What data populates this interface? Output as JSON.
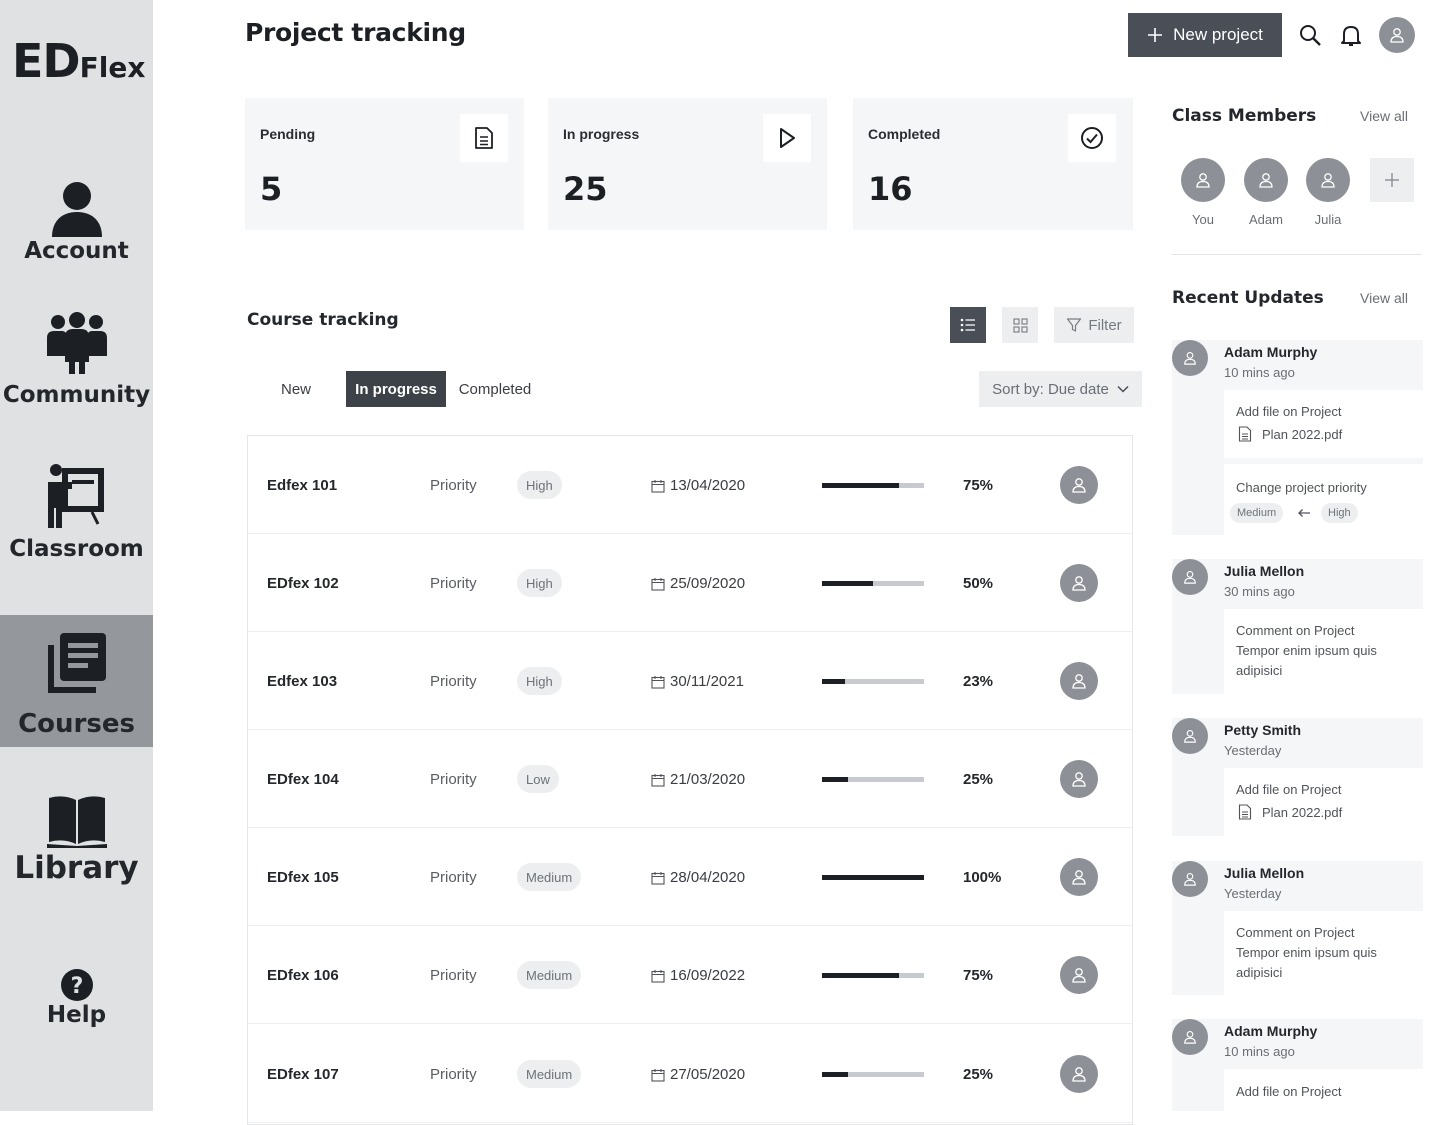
{
  "app": {
    "logo_big": "ED",
    "logo_small": "Flex"
  },
  "nav": {
    "items": [
      {
        "label": "Account",
        "icon": "account-icon"
      },
      {
        "label": "Community",
        "icon": "community-icon"
      },
      {
        "label": "Classroom",
        "icon": "classroom-icon"
      },
      {
        "label": "Courses",
        "icon": "courses-icon",
        "active": true
      },
      {
        "label": "Library",
        "icon": "library-icon"
      },
      {
        "label": "Help",
        "icon": "help-icon"
      }
    ]
  },
  "header": {
    "title": "Project tracking",
    "new_project_label": "New project"
  },
  "stats": [
    {
      "label": "Pending",
      "value": "5",
      "icon": "document-icon"
    },
    {
      "label": "In progress",
      "value": "25",
      "icon": "play-icon"
    },
    {
      "label": "Completed",
      "value": "16",
      "icon": "check-circle-icon"
    }
  ],
  "courses": {
    "title": "Course tracking",
    "filter_label": "Filter",
    "tabs": [
      "New",
      "In progress",
      "Completed"
    ],
    "active_tab": "In progress",
    "sort_label": "Sort by: Due date",
    "rows": [
      {
        "name": "Edfex 101",
        "priority_label": "Priority",
        "priority": "High",
        "date": "13/04/2020",
        "progress": 75,
        "percent": "75%"
      },
      {
        "name": "EDfex 102",
        "priority_label": "Priority",
        "priority": "High",
        "date": "25/09/2020",
        "progress": 50,
        "percent": "50%"
      },
      {
        "name": "Edfex 103",
        "priority_label": "Priority",
        "priority": "High",
        "date": "30/11/2021",
        "progress": 23,
        "percent": "23%"
      },
      {
        "name": "EDfex 104",
        "priority_label": "Priority",
        "priority": "Low",
        "date": "21/03/2020",
        "progress": 25,
        "percent": "25%"
      },
      {
        "name": "EDfex 105",
        "priority_label": "Priority",
        "priority": "Medium",
        "date": "28/04/2020",
        "progress": 100,
        "percent": "100%"
      },
      {
        "name": "EDfex 106",
        "priority_label": "Priority",
        "priority": "Medium",
        "date": "16/09/2022",
        "progress": 75,
        "percent": "75%"
      },
      {
        "name": "EDfex 107",
        "priority_label": "Priority",
        "priority": "Medium",
        "date": "27/05/2020",
        "progress": 25,
        "percent": "25%"
      }
    ]
  },
  "members": {
    "title": "Class Members",
    "view_all": "View all",
    "list": [
      {
        "name": "You"
      },
      {
        "name": "Adam"
      },
      {
        "name": "Julia"
      }
    ]
  },
  "updates": {
    "title": "Recent Updates",
    "view_all": "View all",
    "list": [
      {
        "name": "Adam Murphy",
        "time": "10 mins ago",
        "action": "Add file on Project",
        "file": "Plan 2022.pdf",
        "action2": "Change project priority",
        "from": "Medium",
        "to": "High"
      },
      {
        "name": "Julia Mellon",
        "time": "30 mins ago",
        "action": "Comment on Project",
        "comment": "Tempor enim ipsum quis adipisici"
      },
      {
        "name": "Petty Smith",
        "time": "Yesterday",
        "action": "Add file on Project",
        "file": "Plan 2022.pdf"
      },
      {
        "name": "Julia Mellon",
        "time": "Yesterday",
        "action": "Comment on Project",
        "comment": "Tempor enim ipsum quis adipisici"
      },
      {
        "name": "Adam Murphy",
        "time": "10 mins ago",
        "action": "Add file on Project"
      }
    ]
  },
  "colors": {
    "sidebar": "#e0e1e3",
    "active_nav": "#94979c",
    "primary_button": "#4a4f57",
    "avatar": "#8d9096"
  }
}
